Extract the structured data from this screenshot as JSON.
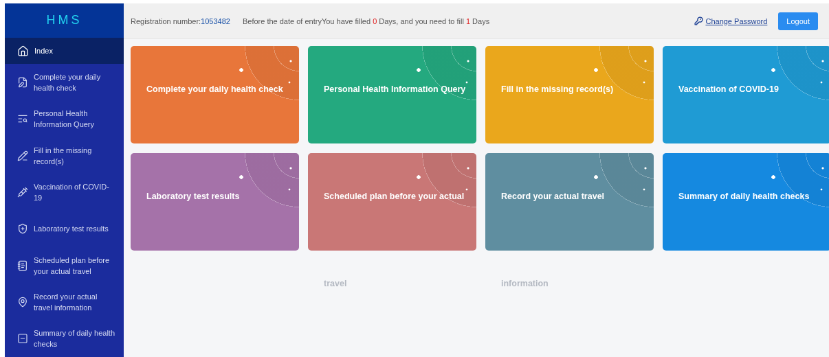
{
  "sidebar": {
    "logo": "HMS",
    "items": [
      {
        "label": "Index",
        "selected": true
      },
      {
        "label": "Complete your daily health check",
        "selected": false
      },
      {
        "label": "Personal Health Information Query",
        "selected": false
      },
      {
        "label": "Fill in the missing record(s)",
        "selected": false
      },
      {
        "label": "Vaccination of COVID-19",
        "selected": false
      },
      {
        "label": "Laboratory test results",
        "selected": false
      },
      {
        "label": "Scheduled plan before your actual travel",
        "selected": false
      },
      {
        "label": "Record your actual travel information",
        "selected": false
      },
      {
        "label": "Summary of daily health checks",
        "selected": false
      }
    ]
  },
  "header": {
    "registration_label": "Registration number:",
    "registration_number": "1053482",
    "notice": {
      "before": "Before the date of entryYou have filled",
      "filled": "0",
      "middle": "Days, and you need to fill",
      "needed": "1",
      "after": "Days"
    },
    "change_password": "Change Password",
    "logout": "Logout"
  },
  "cards": [
    {
      "title": "Complete your daily health check",
      "color": "#e8763a"
    },
    {
      "title": "Personal Health Information Query",
      "color": "#24a97f"
    },
    {
      "title": "Fill in the missing record(s)",
      "color": "#eaa71c"
    },
    {
      "title": "Vaccination of COVID-19",
      "color": "#1f9bd4"
    },
    {
      "title": "Laboratory test results",
      "color": "#a572a9"
    },
    {
      "title": "Scheduled plan before your actual",
      "title_overflow": "travel",
      "color": "#c97776"
    },
    {
      "title": "Record your actual travel",
      "title_overflow": "information",
      "color": "#5f8ea0"
    },
    {
      "title": "Summary of daily health checks",
      "color": "#1589e0"
    }
  ]
}
